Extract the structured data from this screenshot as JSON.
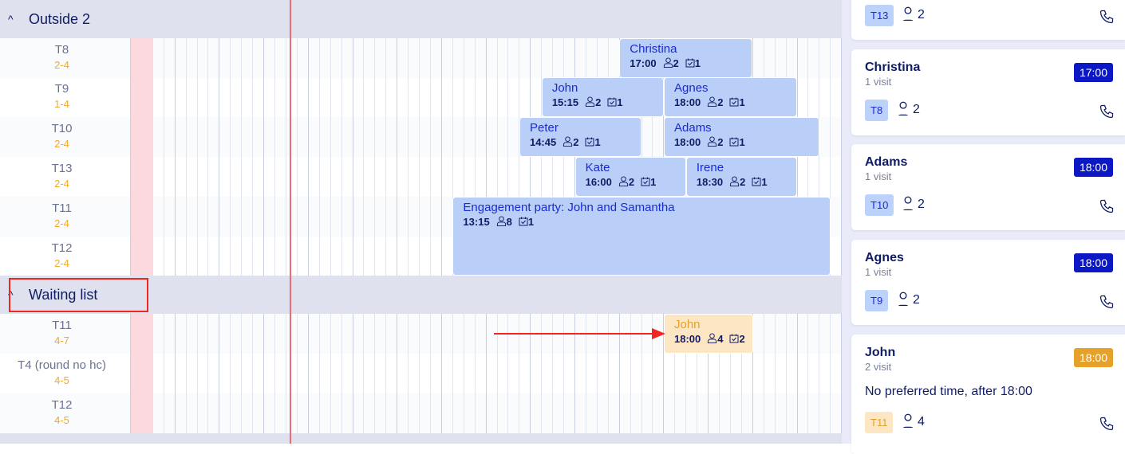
{
  "sections": [
    {
      "title": "Outside 2",
      "rows": [
        {
          "name": "T8",
          "capacity": "2-4"
        },
        {
          "name": "T9",
          "capacity": "1-4"
        },
        {
          "name": "T10",
          "capacity": "2-4"
        },
        {
          "name": "T13",
          "capacity": "2-4"
        },
        {
          "name": "T11",
          "capacity": "2-4"
        },
        {
          "name": "T12",
          "capacity": "2-4"
        }
      ]
    },
    {
      "title": "Waiting list",
      "rows": [
        {
          "name": "T11",
          "capacity": "4-7"
        },
        {
          "name": "T4 (round no hc)",
          "capacity": "4-5"
        },
        {
          "name": "T12",
          "capacity": "4-5"
        }
      ]
    }
  ],
  "bookings": [
    {
      "name": "Christina",
      "time": "17:00",
      "guests": "2",
      "visits": "1"
    },
    {
      "name": "John",
      "time": "15:15",
      "guests": "2",
      "visits": "1"
    },
    {
      "name": "Agnes",
      "time": "18:00",
      "guests": "2",
      "visits": "1"
    },
    {
      "name": "Peter",
      "time": "14:45",
      "guests": "2",
      "visits": "1"
    },
    {
      "name": "Adams",
      "time": "18:00",
      "guests": "2",
      "visits": "1"
    },
    {
      "name": "Kate",
      "time": "16:00",
      "guests": "2",
      "visits": "1"
    },
    {
      "name": "Irene",
      "time": "18:30",
      "guests": "2",
      "visits": "1"
    },
    {
      "name": "Engagement party: John and Samantha",
      "time": "13:15",
      "guests": "8",
      "visits": "1"
    },
    {
      "name": "John",
      "time": "18:00",
      "guests": "4",
      "visits": "2",
      "waiting": true
    }
  ],
  "panel": {
    "cards": [
      {
        "table": "T13",
        "guests": "2"
      },
      {
        "name": "Christina",
        "visits": "1 visit",
        "time": "17:00",
        "table": "T8",
        "guests": "2"
      },
      {
        "name": "Adams",
        "visits": "1 visit",
        "time": "18:00",
        "table": "T10",
        "guests": "2"
      },
      {
        "name": "Agnes",
        "visits": "1 visit",
        "time": "18:00",
        "table": "T9",
        "guests": "2"
      },
      {
        "name": "John",
        "visits": "2 visit",
        "time": "18:00",
        "note": "No preferred time, after 18:00",
        "table": "T11",
        "guests": "4",
        "waiting": true
      }
    ]
  },
  "colors": {
    "accent": "#0b18c4",
    "booking": "#b9cff8",
    "waiting": "#e6a12b",
    "now_line": "#f06a73",
    "annotation": "#f2261c"
  }
}
